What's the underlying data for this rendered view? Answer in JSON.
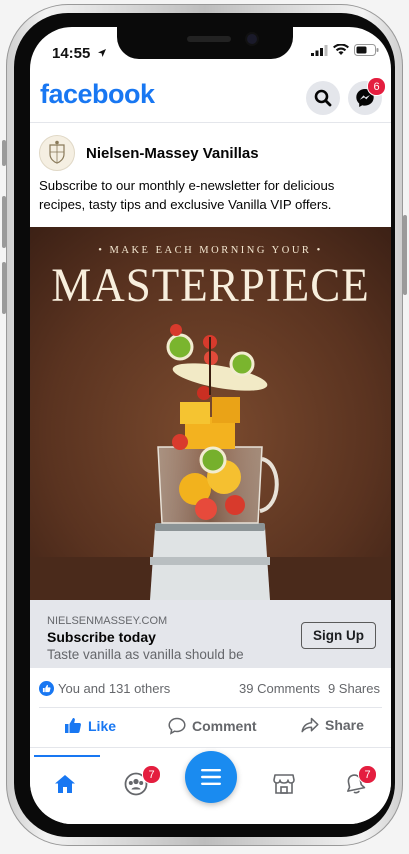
{
  "status": {
    "time": "14:55"
  },
  "header": {
    "logo": "facebook",
    "messenger_badge": "6"
  },
  "post": {
    "page_name": "Nielsen-Massey Vanillas",
    "text": "Subscribe to our monthly e-newsletter for delicious recipes, tasty tips and exclusive Vanilla VIP offers.",
    "image": {
      "tagline": "• MAKE EACH MORNING YOUR •",
      "headline": "MASTERPIECE"
    },
    "cta": {
      "domain": "NIELSENMASSEY.COM",
      "title": "Subscribe today",
      "description": "Taste vanilla as vanilla should be",
      "button": "Sign Up"
    },
    "reactions": "You and 131 others",
    "comments": "39 Comments",
    "shares": "9 Shares",
    "actions": {
      "like": "Like",
      "comment": "Comment",
      "share": "Share"
    }
  },
  "tabbar": {
    "groups_badge": "7",
    "notifications_badge": "7"
  },
  "colors": {
    "brand": "#1877f2",
    "badge": "#e41e3f",
    "cta_bg": "#e4e6eb"
  }
}
